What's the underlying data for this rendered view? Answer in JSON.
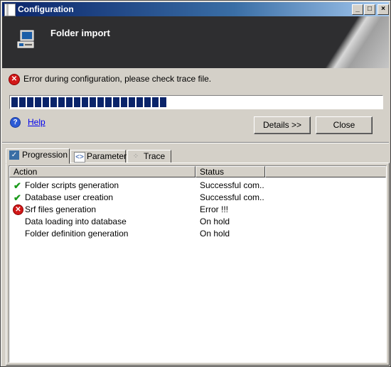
{
  "window": {
    "title": "Configuration",
    "controls": {
      "minimize": "_",
      "maximize": "□",
      "close": "×"
    }
  },
  "banner": {
    "title": "Folder import",
    "icon": "computer-monitor-icon"
  },
  "error": {
    "text": "Error during configuration, please check trace file.",
    "icon": "error-icon"
  },
  "progress": {
    "segments_filled": 20,
    "fraction": 0.41
  },
  "help": {
    "label": "Help",
    "icon": "help-icon"
  },
  "buttons": {
    "details": "Details >>",
    "close": "Close"
  },
  "tabs": [
    {
      "label": "Progression",
      "icon": "progression-icon",
      "active": true
    },
    {
      "label": "Parameter",
      "icon": "parameter-icon",
      "active": false
    },
    {
      "label": "Trace",
      "icon": "trace-icon",
      "active": false
    }
  ],
  "table": {
    "columns": [
      "Action",
      "Status"
    ],
    "rows": [
      {
        "icon": "checkmark-icon",
        "action": "Folder scripts generation",
        "status": "Successful com..."
      },
      {
        "icon": "checkmark-icon",
        "action": "Database user creation",
        "status": "Successful com..."
      },
      {
        "icon": "error-icon",
        "action": "Srf files generation",
        "status": "Error !!!"
      },
      {
        "icon": "",
        "action": "Data loading into database",
        "status": "On hold"
      },
      {
        "icon": "",
        "action": "Folder definition generation",
        "status": "On hold"
      }
    ]
  },
  "colors": {
    "title_bar": "#0a246a",
    "progress": "#0a246a",
    "error": "#d21818",
    "success": "#1a9a1a",
    "banner": "#2e2e30"
  }
}
